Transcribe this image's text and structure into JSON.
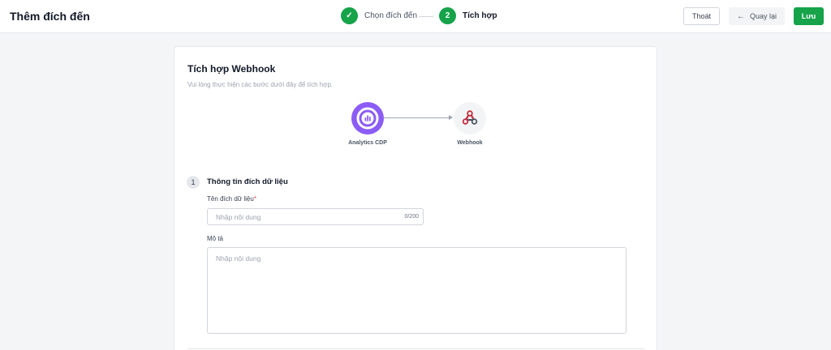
{
  "header": {
    "title": "Thêm đích đến",
    "steps": [
      {
        "number": "✓",
        "label": "Chọn đích đến",
        "state": "done"
      },
      {
        "number": "2",
        "label": "Tích hợp",
        "state": "active"
      }
    ],
    "buttons": {
      "exit": "Thoát",
      "back": "Quay lại",
      "save": "Lưu"
    }
  },
  "card": {
    "title": "Tích hợp Webhook",
    "subtitle": "Vui lòng thực hiện các bước dưới đây để tích hợp.",
    "flow": {
      "source": "Analytics CDP",
      "destination": "Webhook"
    },
    "section": {
      "number": "1",
      "title": "Thông tin đích dữ liệu"
    },
    "fields": {
      "name": {
        "label": "Tên đích dữ liệu",
        "required_mark": "*",
        "placeholder": "Nhập nội dung",
        "counter": "0/200"
      },
      "description": {
        "label": "Mô tả",
        "placeholder": "Nhập nội dung"
      }
    }
  },
  "colors": {
    "accent": "#16a34a",
    "source_node": "#8b5cf6",
    "webhook_icon": "#c62a3a"
  },
  "icons": {
    "step_done": "check-icon",
    "back": "arrow-left-icon",
    "source": "analytics-cdp-logo-icon",
    "destination": "webhook-icon"
  }
}
